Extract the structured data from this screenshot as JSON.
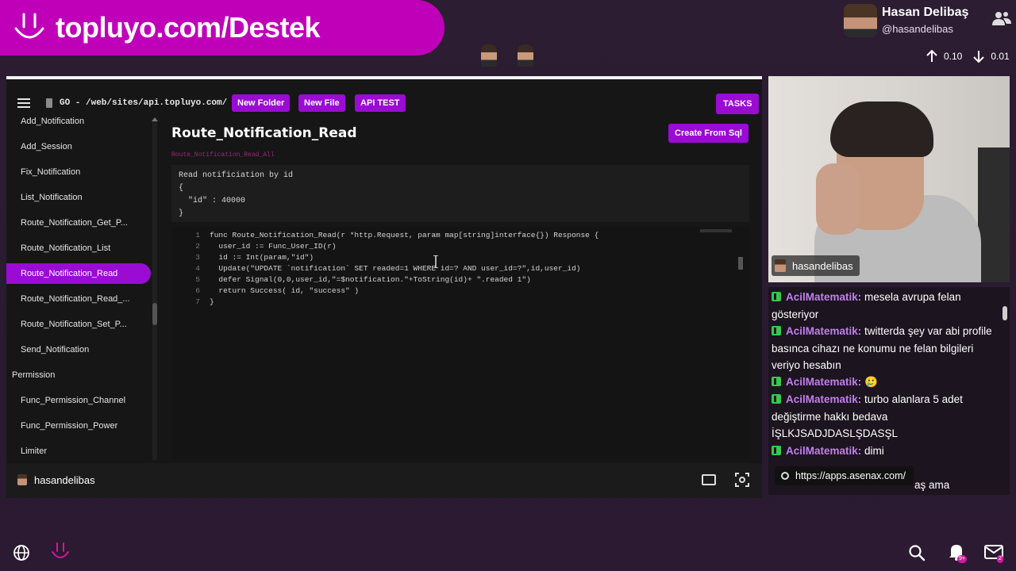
{
  "banner": {
    "text": "topluyo.com/Destek"
  },
  "profile": {
    "name": "Hasan Delibaş",
    "handle": "@hasandelibas",
    "up": "0.10",
    "down": "0.01"
  },
  "toolbar": {
    "path": "GO - /web/sites/api.topluyo.com/",
    "new_folder": "New Folder",
    "new_file": "New File",
    "api_test": "API TEST",
    "tasks": "TASKS"
  },
  "sidebar": {
    "items": [
      "Add_Notification",
      "Add_Session",
      "Fix_Notification",
      "List_Notification",
      "Route_Notification_Get_P...",
      "Route_Notification_List",
      "Route_Notification_Read",
      "Route_Notification_Read_...",
      "Route_Notification_Set_P...",
      "Send_Notification"
    ],
    "section": "Permission",
    "items2": [
      "Func_Permission_Channel",
      "Func_Permission_Power",
      "Limiter"
    ]
  },
  "main": {
    "title": "Route_Notification_Read",
    "create_btn": "Create From Sql",
    "subtitle": "Route_Notification_Read_All",
    "description": "Read notificiation by id\n{\n  \"id\" : 40000\n}"
  },
  "code": {
    "line_numbers": [
      "1",
      "2",
      "3",
      "4",
      "5",
      "6",
      "7"
    ],
    "lines": [
      "func Route_Notification_Read(r *http.Request, param map[string]interface{}) Response {",
      "  user_id := Func_User_ID(r)",
      "  id := Int(param,\"id\")",
      "  Update(\"UPDATE `notification` SET readed=1 WHERE id=? AND user_id=?\",id,user_id)",
      "  defer Signal(0,0,user_id,\"=$notification.\"+ToString(id)+ \".readed 1\")",
      "  return Success( id, \"success\" )",
      "}"
    ]
  },
  "window_footer": {
    "name": "hasandelibas"
  },
  "webcam": {
    "label": "hasandelibas"
  },
  "chat": {
    "messages": [
      {
        "user": "AcilMatematik:",
        "text": "mesela avrupa felan gösteriyor"
      },
      {
        "user": "AcilMatematik:",
        "text": "twitterda şey var abi profile basınca cihazı ne konumu ne felan bilgileri veriyo hesabın"
      },
      {
        "user": "AcilMatematik:",
        "text": "🥲"
      },
      {
        "user": "AcilMatematik:",
        "text": "turbo alanlara 5 adet değiştirme hakkı bedava İŞLKJSADJDASLŞDASŞL"
      },
      {
        "user": "AcilMatematik:",
        "text": "dimi"
      }
    ],
    "partial": "aş ama",
    "url": "https://apps.asenax.com/"
  },
  "bottom": {
    "bell_badge": "9+",
    "mail_badge": "2"
  },
  "colors": {
    "accent": "#9a0bd4",
    "banner": "#c000b8",
    "chat_user": "#c17ff0"
  }
}
